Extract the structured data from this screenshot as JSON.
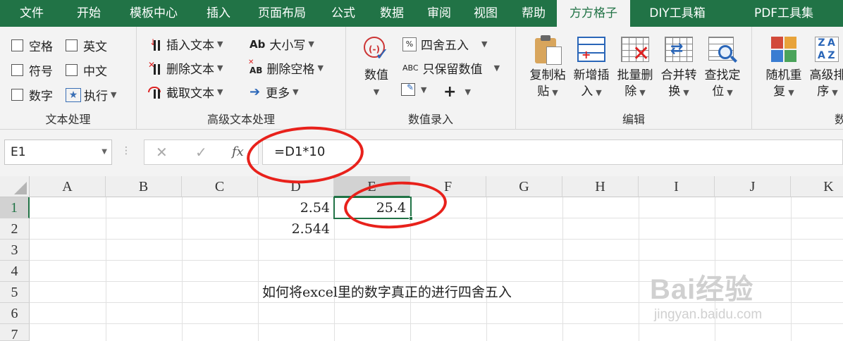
{
  "menu": {
    "tabs": [
      "文件",
      "开始",
      "模板中心",
      "插入",
      "页面布局",
      "公式",
      "数据",
      "审阅",
      "视图",
      "帮助",
      "方方格子",
      "DIY工具箱",
      "PDF工具集"
    ],
    "active": "方方格子"
  },
  "ribbon": {
    "text_processing": {
      "label": "文本处理",
      "items": [
        "空格",
        "英文",
        "符号",
        "中文",
        "数字",
        "执行"
      ]
    },
    "advanced_text": {
      "label": "高级文本处理",
      "insert": "插入文本",
      "delete": "删除文本",
      "cut": "截取文本",
      "case": "大小写",
      "remove_space": "删除空格",
      "more": "更多",
      "case_icon": "Ab",
      "remove_space_icon": "AB"
    },
    "numeric_input": {
      "label": "数值录入",
      "value": "数值",
      "round": "四舍五入",
      "keep_values": "只保留数值",
      "keep_values_icon": "ABC"
    },
    "edit": {
      "label": "编辑",
      "copy_paste": [
        "复制粘",
        "贴"
      ],
      "add_insert": [
        "新增插",
        "入"
      ],
      "batch_delete": [
        "批量删",
        "除"
      ],
      "merge_convert": [
        "合并转",
        "换"
      ],
      "find_locate": [
        "查找定",
        "位"
      ]
    },
    "next_group": {
      "random_repeat": [
        "随机重",
        "复"
      ],
      "advanced_sort": [
        "高级排",
        "序"
      ],
      "label_partial": "数据"
    }
  },
  "formula_bar": {
    "name_box": "E1",
    "fx_label": "fx",
    "formula": "=D1*10"
  },
  "sheet": {
    "columns": [
      "A",
      "B",
      "C",
      "D",
      "E",
      "F",
      "G",
      "H",
      "I",
      "J",
      "K"
    ],
    "rows": [
      "1",
      "2",
      "3",
      "4",
      "5",
      "6",
      "7"
    ],
    "cells": {
      "D1": "2.54",
      "E1": "25.4",
      "D2": "2.544"
    },
    "caption": "如何将excel里的数字真正的进行四舍五入",
    "selected_cell": "E1"
  },
  "watermark": {
    "logo": "Bai经验",
    "url": "jingyan.baidu.com"
  },
  "colors": {
    "accent": "#217346",
    "annotation_red": "#e8211b"
  }
}
